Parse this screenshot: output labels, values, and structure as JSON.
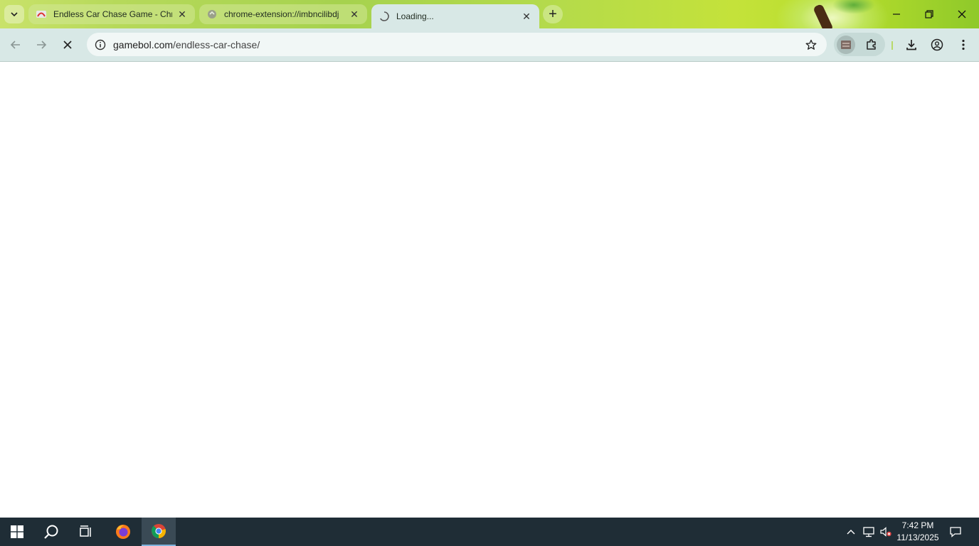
{
  "browser": {
    "tabs": [
      {
        "title": "Endless Car Chase Game - Chro",
        "favicon": "game-favicon"
      },
      {
        "title": "chrome-extension://imbncilibdj",
        "favicon": "extension-favicon"
      },
      {
        "title": "Loading...",
        "favicon": "loading-spinner-icon"
      }
    ],
    "address": {
      "domain": "gamebol.com",
      "path": "/endless-car-chase/"
    }
  },
  "taskbar": {
    "time": "7:42 PM",
    "date": "11/13/2025"
  },
  "colors": {
    "toolbar": "#d8e8e6",
    "taskbar": "#1f2d36",
    "accent": "#b6d95a"
  }
}
